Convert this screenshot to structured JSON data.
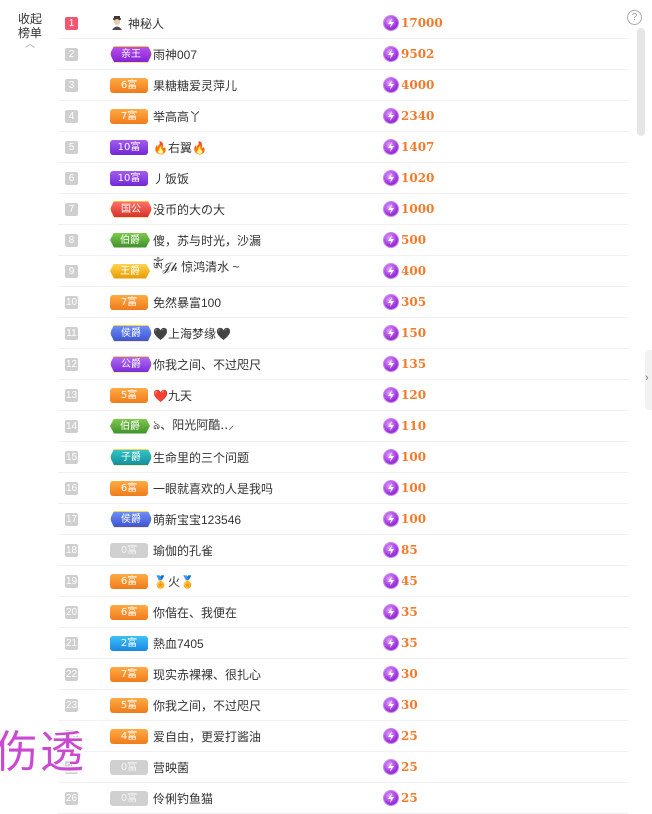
{
  "panel": {
    "collapse_label_line1": "收起",
    "collapse_label_line2": "榜单",
    "help_symbol": "?"
  },
  "accent_colors": {
    "score": "#f17a2b",
    "top_rank": "#f4566f",
    "coin": "#a23ae0"
  },
  "rows": [
    {
      "rank": "1",
      "badge": "",
      "name": "神秘人",
      "score": "17000",
      "anon": true
    },
    {
      "rank": "2",
      "badge": "亲王",
      "name": "雨神007",
      "score": "9502"
    },
    {
      "rank": "3",
      "badge": "6富",
      "name": "果糖糖爱灵萍儿",
      "score": "4000"
    },
    {
      "rank": "4",
      "badge": "7富",
      "name": "举高高丫",
      "score": "2340"
    },
    {
      "rank": "5",
      "badge": "10富",
      "name": "🔥右翼🔥",
      "score": "1407"
    },
    {
      "rank": "6",
      "badge": "10富",
      "name": "丿饭饭",
      "score": "1020"
    },
    {
      "rank": "7",
      "badge": "国公",
      "name": "没币的大の大",
      "score": "1000"
    },
    {
      "rank": "8",
      "badge": "伯爵",
      "name": "傻，苏与时光，沙漏",
      "score": "500"
    },
    {
      "rank": "9",
      "badge": "王爵",
      "name": "ༀ𝒥𝒽 惊鸿清水 ~",
      "score": "400"
    },
    {
      "rank": "10",
      "badge": "7富",
      "name": "免然暴富100",
      "score": "305"
    },
    {
      "rank": "11",
      "badge": "侯爵",
      "name": "🖤上海梦缘🖤",
      "score": "150"
    },
    {
      "rank": "12",
      "badge": "公爵",
      "name": "你我之间、不过咫尺",
      "score": "135"
    },
    {
      "rank": "13",
      "badge": "5富",
      "name": "❤️九天",
      "score": "120"
    },
    {
      "rank": "14",
      "badge": "伯爵",
      "name": "ঌ、阳光阿酷‥⸝",
      "score": "110"
    },
    {
      "rank": "15",
      "badge": "子爵",
      "name": "生命里的三个问题",
      "score": "100"
    },
    {
      "rank": "16",
      "badge": "6富",
      "name": "一眼就喜欢的人是我吗",
      "score": "100"
    },
    {
      "rank": "17",
      "badge": "侯爵",
      "name": "萌新宝宝123546",
      "score": "100"
    },
    {
      "rank": "18",
      "badge": "0富",
      "name": "瑜伽的孔雀",
      "score": "85"
    },
    {
      "rank": "19",
      "badge": "6富",
      "name": "🏅火🏅",
      "score": "45"
    },
    {
      "rank": "20",
      "badge": "6富",
      "name": "你偕在、我便在",
      "score": "35"
    },
    {
      "rank": "21",
      "badge": "2富",
      "name": "熱血7405",
      "score": "35"
    },
    {
      "rank": "22",
      "badge": "7富",
      "name": "现实赤裸裸、很扎心",
      "score": "30"
    },
    {
      "rank": "23",
      "badge": "5富",
      "name": "你我之间，不过咫尺",
      "score": "30"
    },
    {
      "rank": "24",
      "badge": "4富",
      "name": "爱自由，更爱打酱油",
      "score": "25"
    },
    {
      "rank": "25",
      "badge": "0富",
      "name": "营映菌",
      "score": "25"
    },
    {
      "rank": "26",
      "badge": "0富",
      "name": "伶俐钓鱼猫",
      "score": "25"
    }
  ],
  "watermark": "伤透"
}
